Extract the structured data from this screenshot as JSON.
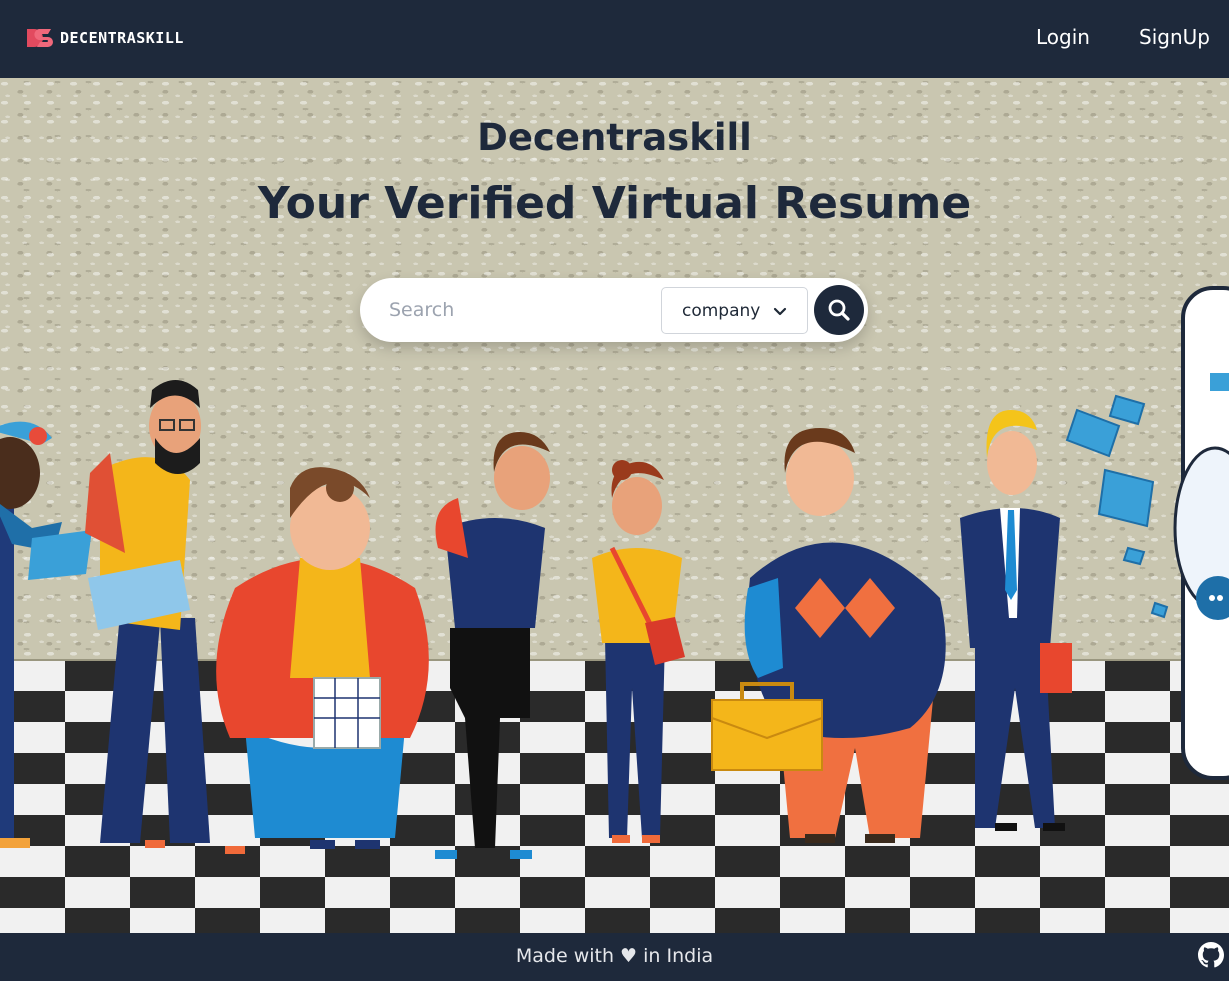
{
  "brand": {
    "logo_text": "DECENTRASKILL",
    "logo_mark_icon": "ds-logo-icon",
    "logo_color": "#e24a5f"
  },
  "nav": {
    "login_label": "Login",
    "signup_label": "SignUp"
  },
  "hero": {
    "title": "Decentraskill",
    "subtitle": "Your Verified Virtual Resume",
    "illustration": "people-queue-illustration"
  },
  "search": {
    "placeholder": "Search",
    "value": "",
    "filter_selected": "company",
    "filter_icon": "chevron-down-icon",
    "button_icon": "search-icon"
  },
  "footer": {
    "text": "Made with ♥ in India",
    "link_icon": "github-icon"
  },
  "colors": {
    "navy": "#1e293b",
    "wall": "#c9c6b0",
    "white": "#ffffff"
  }
}
